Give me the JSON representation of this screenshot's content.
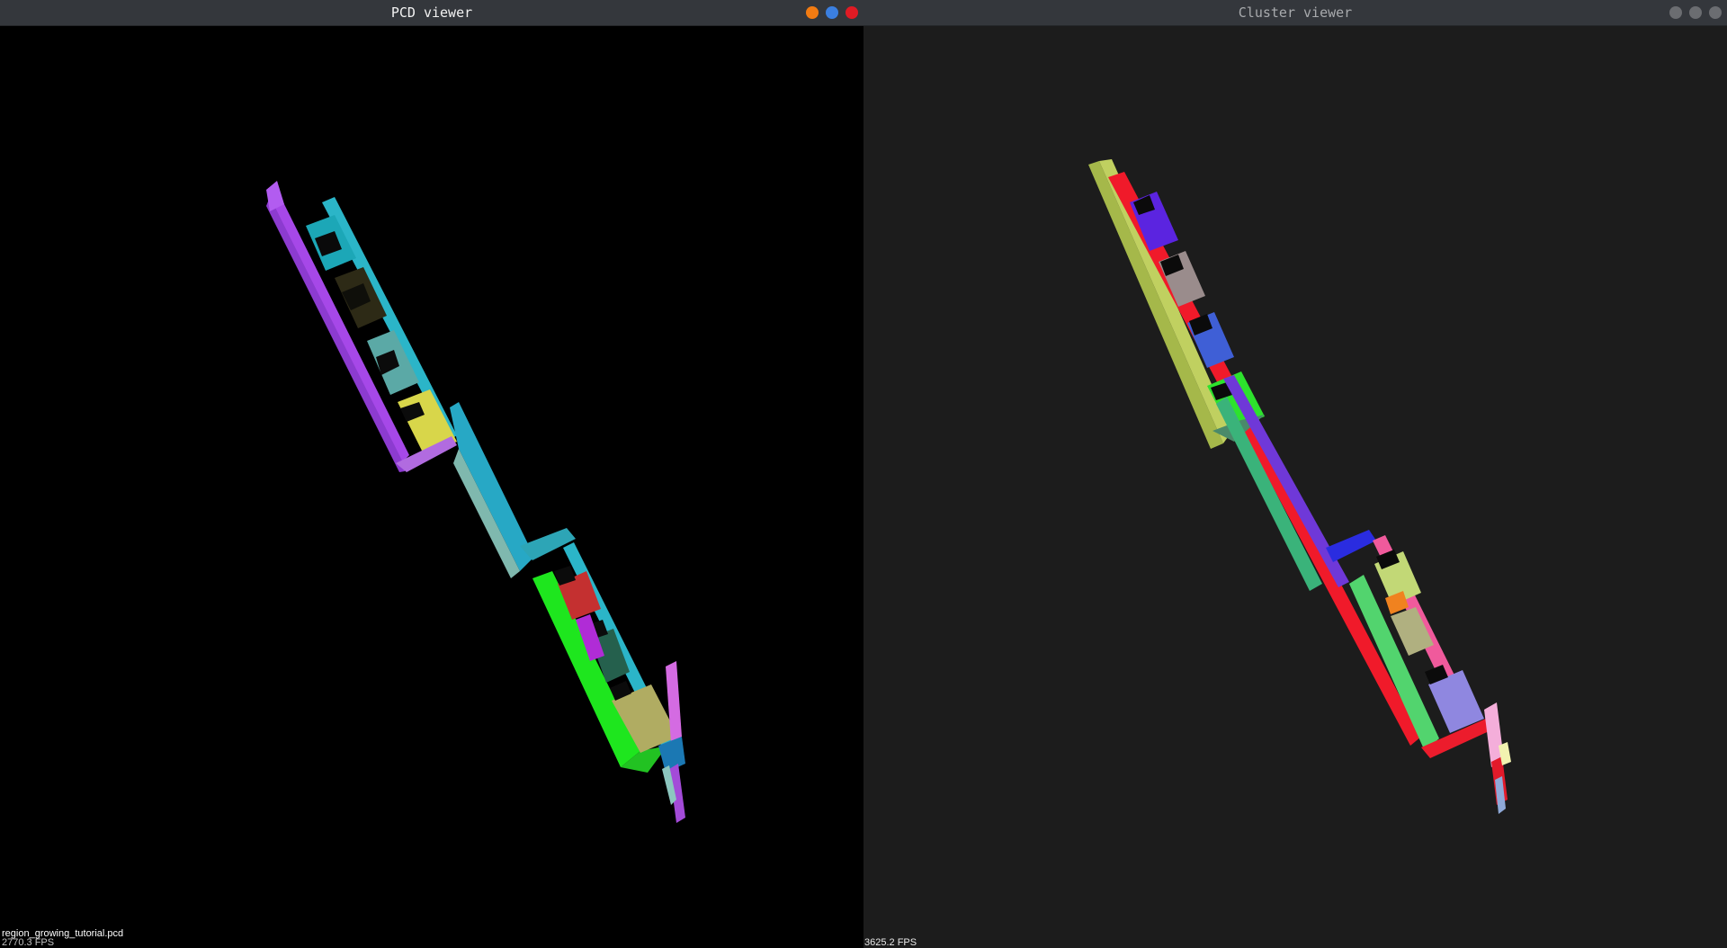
{
  "left_window": {
    "title": "PCD viewer",
    "controls": [
      {
        "name": "minimize",
        "color": "#f27b12"
      },
      {
        "name": "maximize",
        "color": "#3b7fe0"
      },
      {
        "name": "close",
        "color": "#e01b24"
      }
    ],
    "file_label": "region_growing_tutorial.pcd",
    "fps": "2770.3 FPS"
  },
  "right_window": {
    "title": "Cluster viewer",
    "controls": [
      {
        "name": "minimize",
        "color": "#6b6d71"
      },
      {
        "name": "maximize",
        "color": "#6b6d71"
      },
      {
        "name": "close",
        "color": "#6b6d71"
      }
    ],
    "fps": "3625.2 FPS"
  },
  "colors": {
    "left_background": "#000000",
    "right_background": "#1c1c1c",
    "titlebar": "#34373c"
  }
}
